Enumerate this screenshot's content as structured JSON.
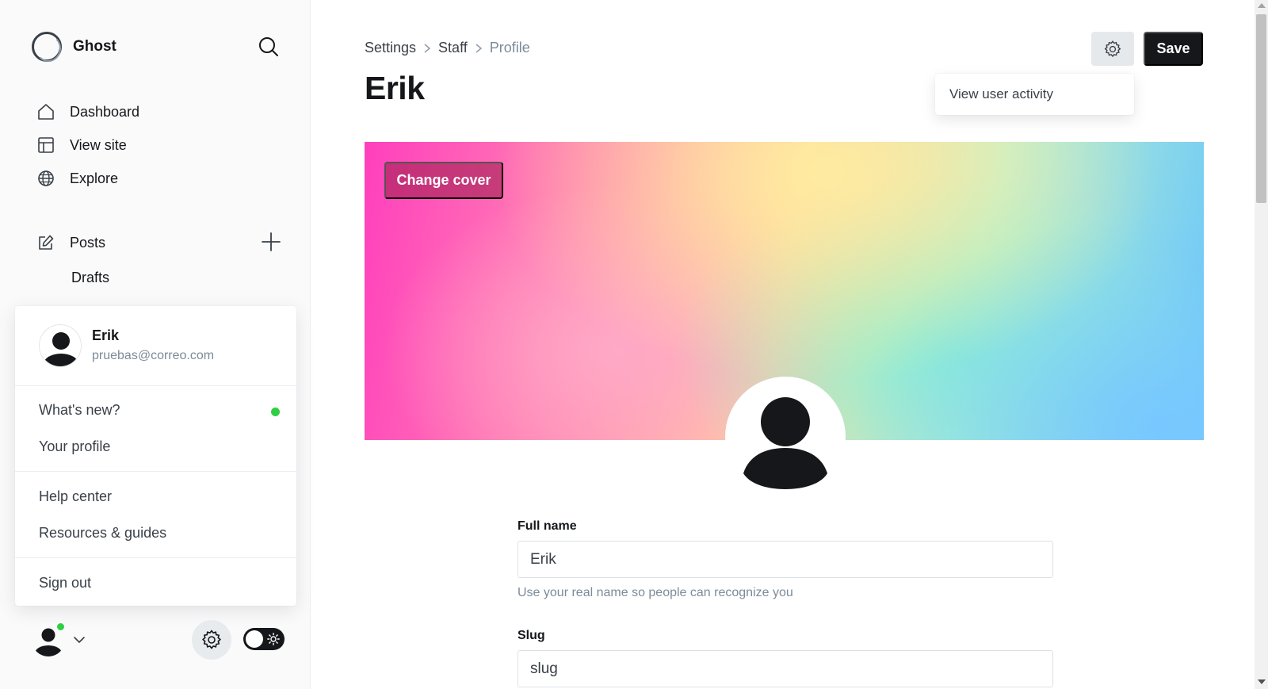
{
  "sidebar": {
    "brand_name": "Ghost",
    "nav": {
      "dashboard": "Dashboard",
      "view_site": "View site",
      "explore": "Explore",
      "posts": "Posts",
      "drafts": "Drafts"
    }
  },
  "user_menu": {
    "name": "Erik",
    "email": "pruebas@correo.com",
    "items": {
      "whats_new": "What's new?",
      "your_profile": "Your profile",
      "help_center": "Help center",
      "resources": "Resources & guides",
      "sign_out": "Sign out"
    },
    "whats_new_dot_color": "#30cf43"
  },
  "breadcrumb": {
    "settings": "Settings",
    "staff": "Staff",
    "profile": "Profile"
  },
  "page_title": "Erik",
  "toolbar": {
    "save_label": "Save"
  },
  "actions_dropdown": {
    "view_user_activity": "View user activity"
  },
  "cover": {
    "change_cover_label": "Change cover"
  },
  "form": {
    "full_name": {
      "label": "Full name",
      "value": "Erik",
      "hint": "Use your real name so people can recognize you"
    },
    "slug": {
      "label": "Slug",
      "value": "slug"
    }
  },
  "colors": {
    "primary_dark": "#15171a",
    "online_green": "#30cf43",
    "muted_text": "#7c8b9a"
  }
}
